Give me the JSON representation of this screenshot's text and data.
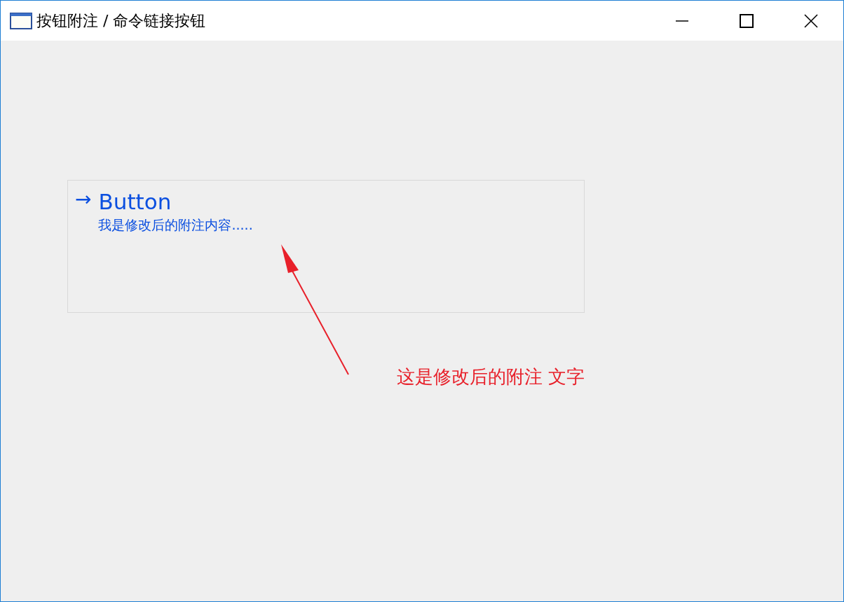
{
  "window": {
    "title": "按钮附注  / 命令链接按钮"
  },
  "command_link": {
    "arrow": "→",
    "label": "Button",
    "note": "我是修改后的附注内容....."
  },
  "annotation": {
    "text": "这是修改后的附注 文字"
  }
}
